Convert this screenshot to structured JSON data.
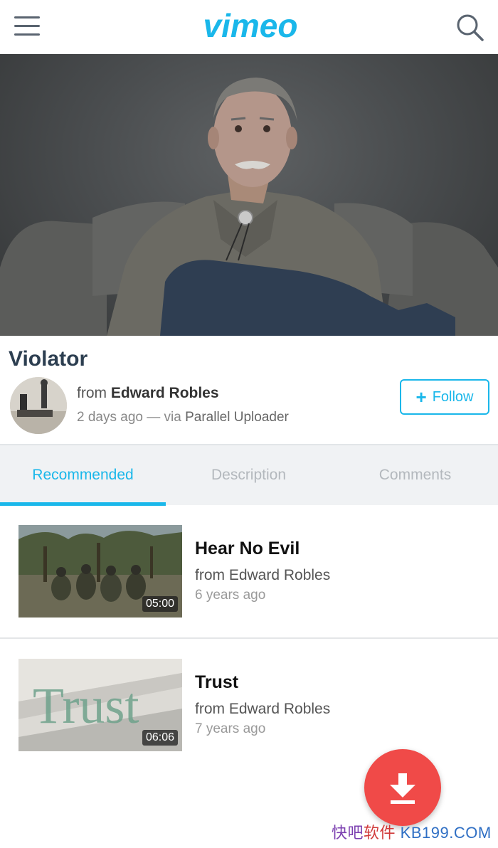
{
  "header": {
    "logo_text": "vimeo",
    "brand_color": "#1ab7ea"
  },
  "video": {
    "title": "Violator",
    "from_prefix": "from",
    "author": "Edward Robles",
    "age": "2 days ago",
    "via_separator": "—",
    "via_prefix": "via",
    "via_app": "Parallel Uploader",
    "follow_label": "Follow",
    "follow_icon": "plus-icon"
  },
  "tabs": [
    {
      "label": "Recommended",
      "active": true
    },
    {
      "label": "Description",
      "active": false
    },
    {
      "label": "Comments",
      "active": false
    }
  ],
  "recommended": [
    {
      "title": "Hear No Evil",
      "from": "from Edward Robles",
      "age": "6 years ago",
      "duration": "05:00"
    },
    {
      "title": "Trust",
      "from": "from Edward Robles",
      "age": "7 years ago",
      "duration": "06:06",
      "thumb_text": "Trust"
    }
  ],
  "fab": {
    "icon": "download-icon",
    "color": "#f04a48"
  },
  "watermark": {
    "cn_a": "快吧",
    "cn_b": "软件",
    "domain": "KB199.COM"
  }
}
